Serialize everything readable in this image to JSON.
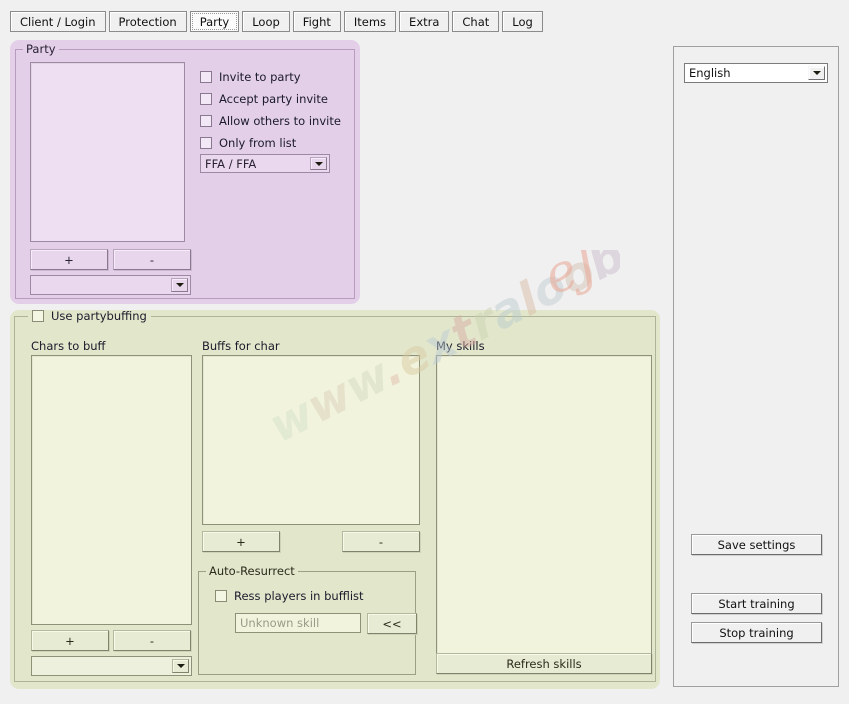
{
  "window": {
    "title": "Party",
    "background_color": "#f0f0f0"
  },
  "tabs": [
    {
      "label": "Client / Login",
      "active": false
    },
    {
      "label": "Protection",
      "active": false
    },
    {
      "label": "Party",
      "active": true
    },
    {
      "label": "Loop",
      "active": false
    },
    {
      "label": "Fight",
      "active": false
    },
    {
      "label": "Items",
      "active": false
    },
    {
      "label": "Extra",
      "active": false
    },
    {
      "label": "Chat",
      "active": false
    },
    {
      "label": "Log",
      "active": false
    }
  ],
  "party": {
    "group_title": "Party",
    "panel_color": "#e3cfe8",
    "list_items": [],
    "checkboxes": [
      {
        "label": "Invite to party",
        "checked": false
      },
      {
        "label": "Accept party invite",
        "checked": false
      },
      {
        "label": "Allow others to invite",
        "checked": false
      },
      {
        "label": "Only from list",
        "checked": false
      }
    ],
    "loot_combo": {
      "value": "FFA / FFA",
      "options": [
        "FFA / FFA"
      ]
    },
    "add_button": "+",
    "remove_button": "-",
    "bottom_combo": {
      "value": "",
      "options": []
    }
  },
  "partybuffing": {
    "group_title": "Use partybuffing",
    "checked": false,
    "panel_color": "#e2e7cc",
    "chars_to_buff": {
      "label": "Chars to buff",
      "items": [],
      "add_button": "+",
      "remove_button": "-",
      "combo": {
        "value": "",
        "options": []
      }
    },
    "buffs_for_char": {
      "label": "Buffs for char",
      "items": [],
      "add_button": "+",
      "remove_button": "-"
    },
    "my_skills": {
      "label": "My skills",
      "items": [],
      "refresh_button": "Refresh skills"
    },
    "auto_resurrect": {
      "group_title": "Auto-Resurrect",
      "checkbox": {
        "label": "Ress players in bufflist",
        "checked": false
      },
      "skill_field": {
        "value": "",
        "placeholder": "Unknown skill"
      },
      "assign_button": "<<"
    }
  },
  "right_panel": {
    "language_combo": {
      "value": "English",
      "options": [
        "English"
      ]
    },
    "save_settings_button": "Save settings",
    "start_training_button": "Start training",
    "stop_training_button": "Stop training"
  },
  "watermark": {
    "text": "www.extraloob.com",
    "logo": "eJ"
  }
}
